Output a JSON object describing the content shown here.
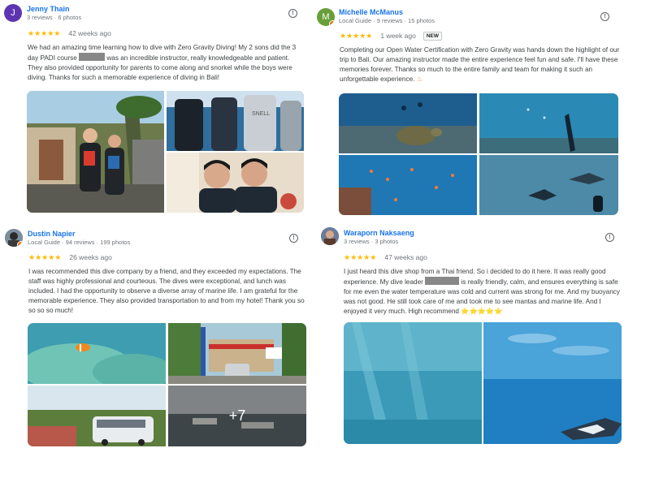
{
  "reviews": [
    {
      "name": "Jenny Thain",
      "meta": "3 reviews · 6 photos",
      "avatar_letter": "J",
      "avatar_color": "#5e35b1",
      "stars": "★★★★★",
      "when": "42 weeks ago",
      "text_a": "We had an amazing time learning how to dive with Zero Gravity Diving! My 2 sons did the 3 day PADI course ",
      "text_b": " was an incredible instructor, really knowledgeable and patient. They also provided opportunity for parents to come along and snorkel while the boys were diving. Thanks for such a memorable experience of diving in Bali!"
    },
    {
      "name": "Michelle McManus",
      "meta": "Local Guide · 9 reviews · 15 photos",
      "avatar_letter": "M",
      "avatar_color": "#689f38",
      "stars": "★★★★★",
      "when": "1 week ago",
      "badge": "NEW",
      "text_a": "Completing our Open Water Certification with Zero Gravity was hands down the highlight of our trip to Bali. Our amazing instructor made the entire experience feel fun and safe. I'll have these memories forever. Thanks so much to the entire family and team for making it such an unforgettable experience. ",
      "emoji": "♨"
    },
    {
      "name": "Dustin Napier",
      "meta": "Local Guide · 94 reviews · 199 photos",
      "stars": "★★★★★",
      "when": "26 weeks ago",
      "text_a": "I was recommended this dive company by a friend, and they exceeded my expectations. The staff was highly professional and courteous. The dives were exceptional, and lunch was included. I had the opportunity to observe a diverse array of marine life. I am grateful for the memorable experience. They also provided transportation to and from my hotel! Thank you so so so so much!",
      "more_photos": "+7"
    },
    {
      "name": "Waraporn Naksaeng",
      "meta": "3 reviews · 3 photos",
      "stars": "★★★★★",
      "when": "47 weeks ago",
      "text_a": "I just heard this dive shop from a Thai friend. So i decided to do it here. It was really good experience. My dive leader ",
      "text_b": " is really friendly, calm, and ensures everything is safe for me even the water temperature was cold and current was strong for me. And my buoyancy was not good. He still took care of me and took me to see mantas and marine life. And I enjoyed it very much. High recommend ",
      "emoji": "⭐⭐⭐⭐⭐"
    }
  ],
  "colors": {
    "link": "#1a73e8",
    "star": "#fbbc04",
    "muted": "#70757a"
  }
}
